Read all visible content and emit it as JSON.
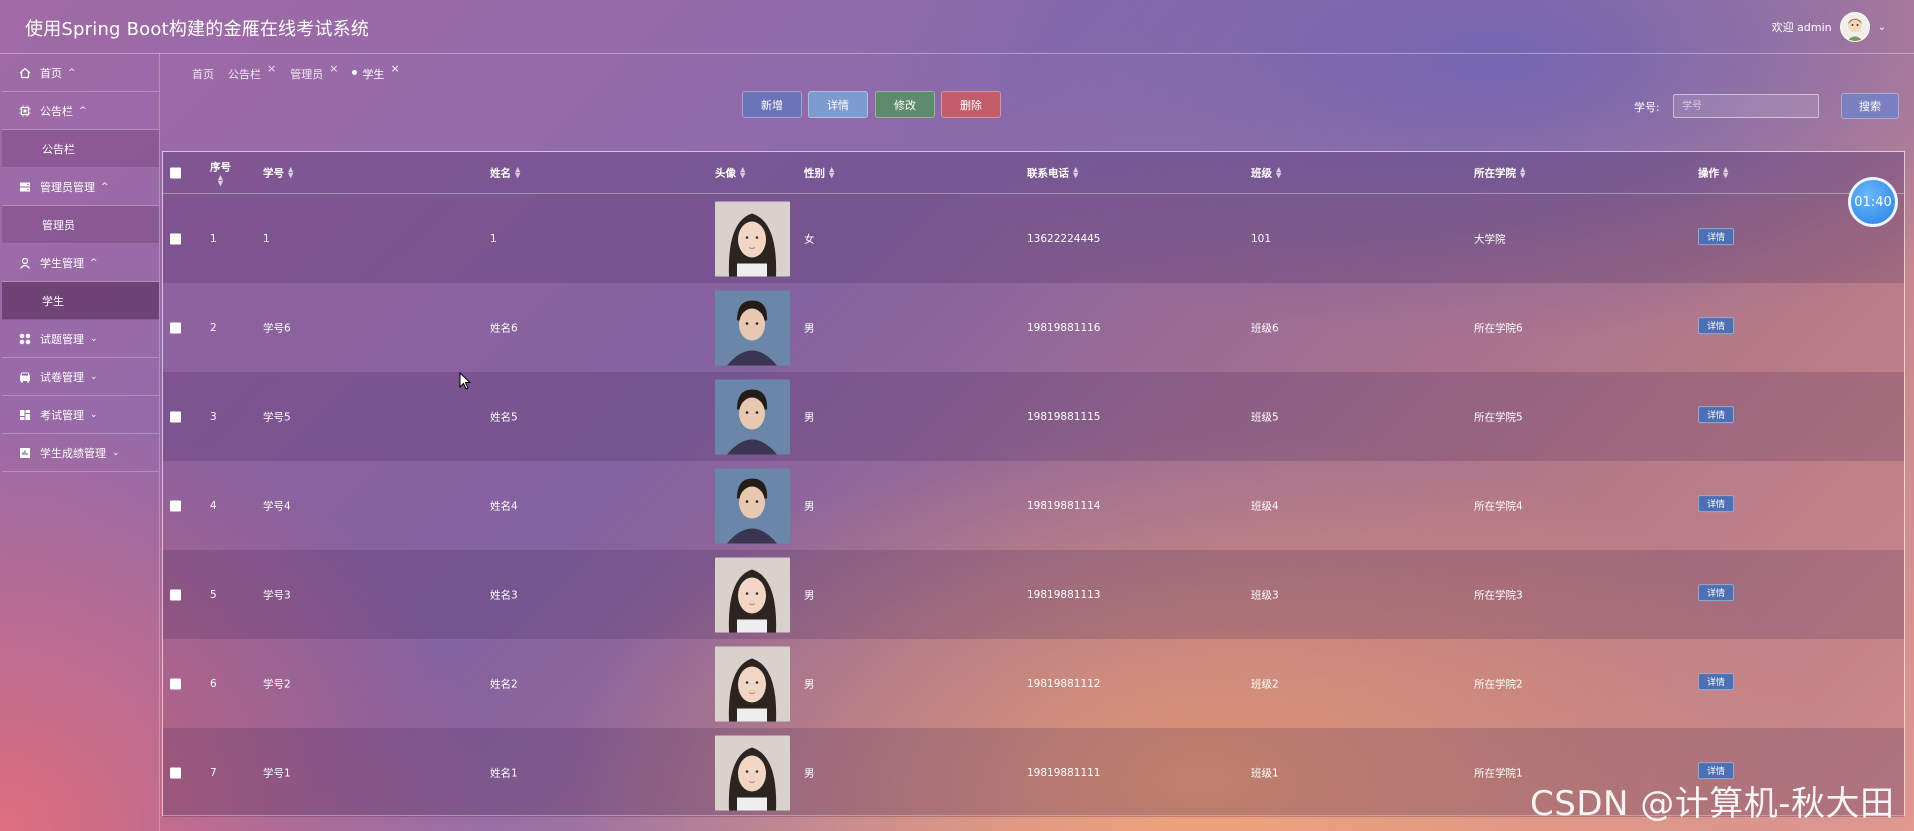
{
  "header": {
    "title": "使用Spring Boot构建的金雁在线考试系统",
    "welcome": "欢迎 admin"
  },
  "sidebar": {
    "items": [
      {
        "label": "首页",
        "icon": "home-icon",
        "arrow": "^"
      },
      {
        "label": "公告栏",
        "icon": "chip-icon",
        "arrow": "^"
      },
      {
        "label": "公告栏",
        "sub": true
      },
      {
        "label": "管理员管理",
        "icon": "server-icon",
        "arrow": "^"
      },
      {
        "label": "管理员",
        "sub": true
      },
      {
        "label": "学生管理",
        "icon": "user-icon",
        "arrow": "^"
      },
      {
        "label": "学生",
        "sub": true,
        "active": true
      },
      {
        "label": "试题管理",
        "icon": "apps-icon",
        "arrow": "v"
      },
      {
        "label": "试卷管理",
        "icon": "car-icon",
        "arrow": "v"
      },
      {
        "label": "考试管理",
        "icon": "grid-icon",
        "arrow": "v"
      },
      {
        "label": "学生成绩管理",
        "icon": "chart-icon",
        "arrow": "v"
      }
    ]
  },
  "tabs": [
    {
      "label": "首页",
      "closable": false
    },
    {
      "label": "公告栏",
      "closable": true
    },
    {
      "label": "管理员",
      "closable": true
    },
    {
      "label": "学生",
      "closable": true,
      "active": true
    }
  ],
  "toolbar": {
    "add": "新增",
    "detail": "详情",
    "edit": "修改",
    "delete": "删除",
    "search_label": "学号:",
    "search_placeholder": "学号",
    "search_button": "搜索"
  },
  "table": {
    "headers": {
      "index": "序号",
      "student_no": "学号",
      "name": "姓名",
      "avatar": "头像",
      "gender": "性别",
      "phone": "联系电话",
      "class": "班级",
      "college": "所在学院",
      "action": "操作"
    },
    "detail_label": "详情",
    "rows": [
      {
        "index": "1",
        "student_no": "1",
        "name": "1",
        "gender": "女",
        "phone": "13622224445",
        "class": "101",
        "college": "大学院",
        "photo": "girl"
      },
      {
        "index": "2",
        "student_no": "学号6",
        "name": "姓名6",
        "gender": "男",
        "phone": "19819881116",
        "class": "班级6",
        "college": "所在学院6",
        "photo": "boy"
      },
      {
        "index": "3",
        "student_no": "学号5",
        "name": "姓名5",
        "gender": "男",
        "phone": "19819881115",
        "class": "班级5",
        "college": "所在学院5",
        "photo": "boy"
      },
      {
        "index": "4",
        "student_no": "学号4",
        "name": "姓名4",
        "gender": "男",
        "phone": "19819881114",
        "class": "班级4",
        "college": "所在学院4",
        "photo": "boy"
      },
      {
        "index": "5",
        "student_no": "学号3",
        "name": "姓名3",
        "gender": "男",
        "phone": "19819881113",
        "class": "班级3",
        "college": "所在学院3",
        "photo": "girl"
      },
      {
        "index": "6",
        "student_no": "学号2",
        "name": "姓名2",
        "gender": "男",
        "phone": "19819881112",
        "class": "班级2",
        "college": "所在学院2",
        "photo": "girl"
      },
      {
        "index": "7",
        "student_no": "学号1",
        "name": "姓名1",
        "gender": "男",
        "phone": "19819881111",
        "class": "班级1",
        "college": "所在学院1",
        "photo": "girl"
      }
    ]
  },
  "clock": "01:40",
  "watermark": "CSDN @计算机-秋大田"
}
